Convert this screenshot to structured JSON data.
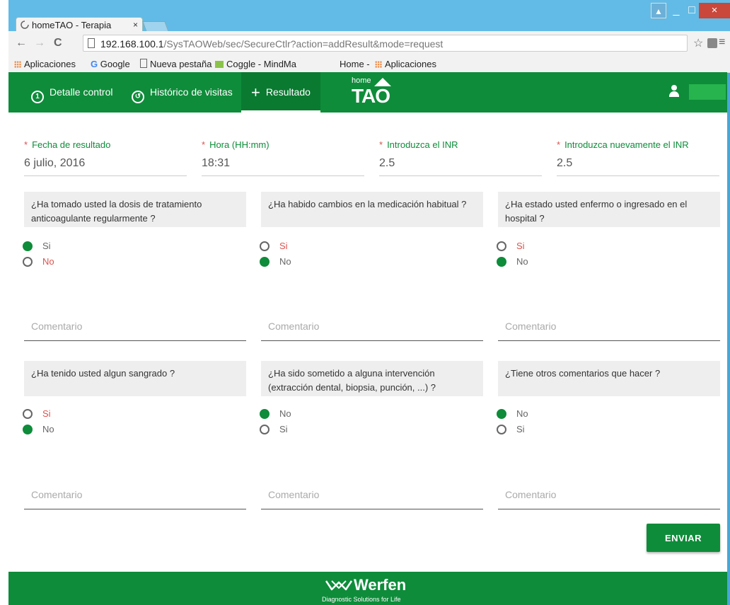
{
  "browser": {
    "tab_title": "homeTAO - Terapia",
    "tab_close": "×",
    "window_user": "▲",
    "window_min": "_",
    "window_max": "□",
    "window_close": "×",
    "nav_back": "←",
    "nav_forward": "→",
    "nav_reload": "C",
    "address_host": "192.168.100.1",
    "address_path": "/SysTAOWeb/sec/SecureCtlr?action=addResult&mode=request",
    "star": "☆",
    "menu": "≡",
    "bookmarks": [
      "Aplicaciones",
      "Google",
      "Nueva pestaña",
      "Coggle - MindMa",
      "Home -",
      "Aplicaciones"
    ]
  },
  "header": {
    "nav": [
      {
        "label": "Detalle control"
      },
      {
        "label": "Histórico de visitas"
      },
      {
        "label": "Resultado"
      }
    ],
    "brand_small": "home",
    "brand_big": "TAO"
  },
  "form": {
    "fields": [
      {
        "label": "Fecha de resultado",
        "value": "6 julio, 2016"
      },
      {
        "label": "Hora (HH:mm)",
        "value": "18:31"
      },
      {
        "label": "Introduzca el INR",
        "value": "2.5"
      },
      {
        "label": "Introduzca nuevamente el INR",
        "value": "2.5"
      }
    ],
    "required_mark": "*",
    "questions": [
      {
        "text": "¿Ha tomado usted la dosis de tratamiento anticoagulante regularmente ?",
        "options": [
          "Si",
          "No"
        ],
        "selected": "Si"
      },
      {
        "text": "¿Ha habido cambios en la medicación habitual ?",
        "options": [
          "Si",
          "No"
        ],
        "selected": "No"
      },
      {
        "text": "¿Ha estado usted enfermo o ingresado en el hospital ?",
        "options": [
          "Si",
          "No"
        ],
        "selected": "No"
      },
      {
        "text": "¿Ha tenido usted algun sangrado ?",
        "options": [
          "Si",
          "No"
        ],
        "selected": "No"
      },
      {
        "text": "¿Ha sido sometido a alguna intervención (extracción dental, biopsia, punción, ...) ?",
        "options": [
          "No",
          "Si"
        ],
        "selected": "No"
      },
      {
        "text": "¿Tiene otros comentarios que hacer ?",
        "options": [
          "No",
          "Si"
        ],
        "selected": "No"
      }
    ],
    "comment_placeholder": "Comentario",
    "submit_label": "ENVIAR"
  },
  "footer": {
    "brand": "Werfen",
    "tagline": "Diagnostic Solutions for Life"
  },
  "colors": {
    "brand_green": "#0e8c3a",
    "required_red": "#d9534f"
  }
}
